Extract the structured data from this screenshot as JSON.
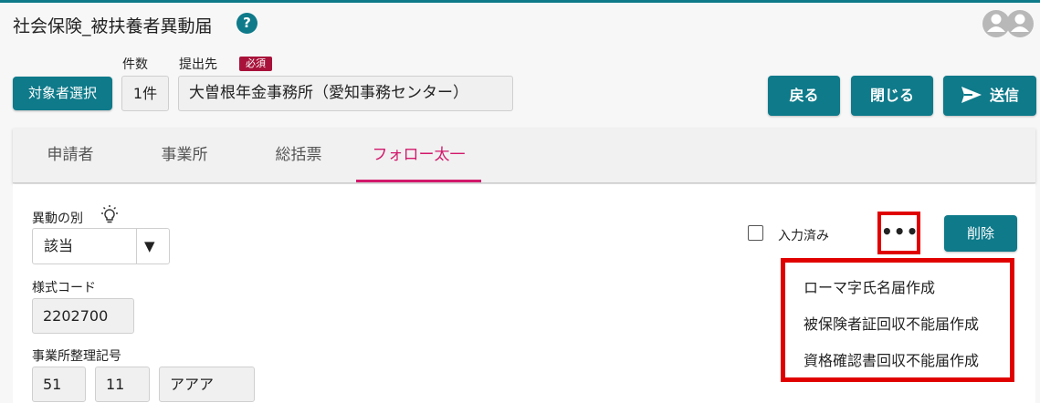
{
  "app": {
    "title": "社会保険_被扶養者異動届",
    "help_glyph": "?"
  },
  "toolbar": {
    "select_target_label": "対象者選択",
    "count_label": "件数",
    "count_value": "1件",
    "destination_label": "提出先",
    "required_badge": "必須",
    "destination_value": "大曽根年金事務所（愛知事務センター）",
    "back_label": "戻る",
    "close_label": "閉じる",
    "send_label": "送信"
  },
  "tabs": [
    {
      "label": "申請者",
      "active": false
    },
    {
      "label": "事業所",
      "active": false
    },
    {
      "label": "総括票",
      "active": false
    },
    {
      "label": "フォロー太一",
      "active": true
    }
  ],
  "form": {
    "change_type_label": "異動の別",
    "change_type_value": "該当",
    "dropdown_arrow": "▼",
    "format_code_label": "様式コード",
    "format_code_value": "2202700",
    "office_code_label": "事業所整理記号",
    "office_code_1": "51",
    "office_code_2": "11",
    "office_code_3": "アアア"
  },
  "actions": {
    "entered_label": "入力済み",
    "more_glyph": "•••",
    "delete_label": "削除"
  },
  "menu": {
    "items": [
      "ローマ字氏名届作成",
      "被保険者証回収不能届作成",
      "資格確認書回収不能届作成"
    ]
  },
  "colors": {
    "accent": "#0e7a8a",
    "active_tab": "#d2186b",
    "required": "#a8123a",
    "highlight": "#e00000"
  },
  "icons": [
    "help-icon",
    "user-avatar-icon",
    "send-arrow-icon",
    "lightbulb-icon",
    "more-icon",
    "dropdown-arrow-icon"
  ]
}
